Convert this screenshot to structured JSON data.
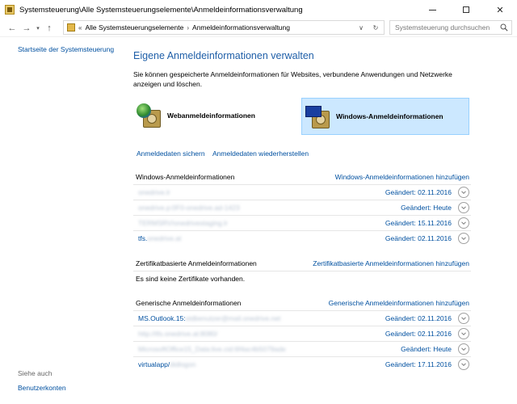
{
  "window": {
    "title": "Systemsteuerung\\Alle Systemsteuerungselemente\\Anmeldeinformationsverwaltung"
  },
  "address": {
    "overflow": "«",
    "segments": [
      "Alle Systemsteuerungselemente",
      "Anmeldeinformationsverwaltung"
    ],
    "search_placeholder": "Systemsteuerung durchsuchen"
  },
  "sidebar": {
    "home_link": "Startseite der Systemsteuerung",
    "see_also": "Siehe auch",
    "accounts_link": "Benutzerkonten"
  },
  "main": {
    "heading": "Eigene Anmeldeinformationen verwalten",
    "description": "Sie können gespeicherte Anmeldeinformationen für Websites, verbundene Anwendungen und Netzwerke anzeigen und löschen.",
    "web_button": "Webanmeldeinformationen",
    "windows_button": "Windows-Anmeldeinformationen",
    "backup_link": "Anmeldedaten sichern",
    "restore_link": "Anmeldedaten wiederherstellen"
  },
  "sections": {
    "windows": {
      "title": "Windows-Anmeldeinformationen",
      "add": "Windows-Anmeldeinformationen hinzufügen",
      "rows": [
        {
          "prefix": "",
          "blurred": "onedrive.lr",
          "changed": "Geändert: 02.11.2016"
        },
        {
          "prefix": "",
          "blurred": "onedrive.p:0F0-onedrive.ad-1423",
          "changed": "Geändert: Heute"
        },
        {
          "prefix": "",
          "blurred": "TERMSRV/onedrivestaging.lr",
          "changed": "Geändert: 15.11.2016"
        },
        {
          "prefix": "tfs.",
          "blurred": "onedrive.at",
          "changed": "Geändert: 02.11.2016"
        }
      ]
    },
    "certificates": {
      "title": "Zertifikatbasierte Anmeldeinformationen",
      "add": "Zertifikatbasierte Anmeldeinformationen hinzufügen",
      "empty": "Es sind keine Zertifikate vorhanden."
    },
    "generic": {
      "title": "Generische Anmeldeinformationen",
      "add": "Generische Anmeldeinformationen hinzufügen",
      "rows": [
        {
          "prefix": "MS.Outlook.15:",
          "blurred": "stdbenutzer@mail.onedrive.net",
          "changed": "Geändert: 02.11.2016"
        },
        {
          "prefix": "",
          "blurred": "http://tfs.onedrive.at:8080/",
          "changed": "Geändert: 02.11.2016"
        },
        {
          "prefix": "",
          "blurred": "MicrosoftOffice15_Data:live.cid:6f4ac4b5079ade",
          "changed": "Geändert: Heute"
        },
        {
          "prefix": "virtualapp/",
          "blurred": "didlogon",
          "changed": "Geändert: 17.11.2016"
        }
      ]
    }
  }
}
